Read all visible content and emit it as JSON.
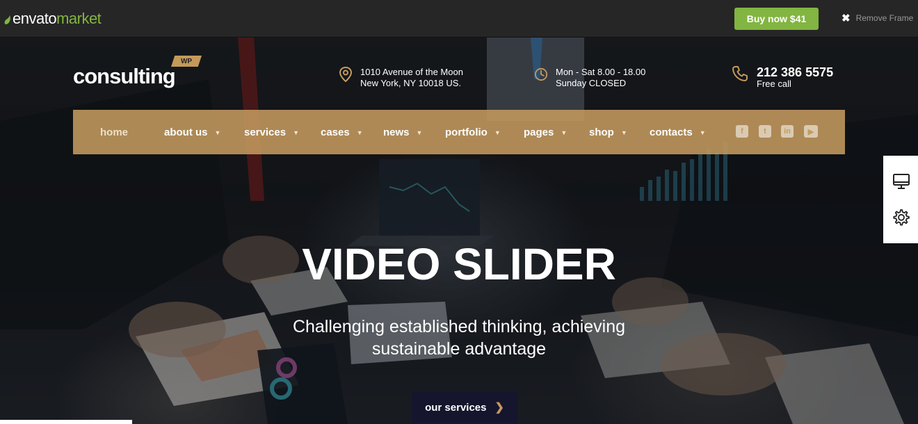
{
  "envato": {
    "logo_primary": "envato",
    "logo_secondary": "market",
    "buy_label": "Buy now $41",
    "remove_label": "Remove Frame",
    "accent": "#82b541"
  },
  "brand": {
    "name": "consulting",
    "badge": "WP",
    "accent": "#c49a5e"
  },
  "contact": {
    "address_line1": "1010 Avenue of the Moon",
    "address_line2": "New York, NY 10018 US.",
    "hours_line1": "Mon - Sat 8.00 - 18.00",
    "hours_line2": "Sunday CLOSED",
    "phone": "212 386 5575",
    "phone_note": "Free call"
  },
  "nav": {
    "items": [
      {
        "label": "home",
        "active": true,
        "dropdown": false
      },
      {
        "label": "about us",
        "dropdown": true
      },
      {
        "label": "services",
        "dropdown": true
      },
      {
        "label": "cases",
        "dropdown": true
      },
      {
        "label": "news",
        "dropdown": true
      },
      {
        "label": "portfolio",
        "dropdown": true
      },
      {
        "label": "pages",
        "dropdown": true
      },
      {
        "label": "shop",
        "dropdown": true
      },
      {
        "label": "contacts",
        "dropdown": true
      }
    ],
    "social_icons": [
      "facebook-icon",
      "twitter-icon",
      "linkedin-icon",
      "youtube-icon"
    ]
  },
  "hero": {
    "title": "VIDEO SLIDER",
    "subtitle_line1": "Challenging established thinking, achieving",
    "subtitle_line2": "sustainable advantage",
    "cta_label": "our services"
  },
  "side_panel": {
    "icons": [
      "monitor-icon",
      "gear-icon"
    ]
  }
}
